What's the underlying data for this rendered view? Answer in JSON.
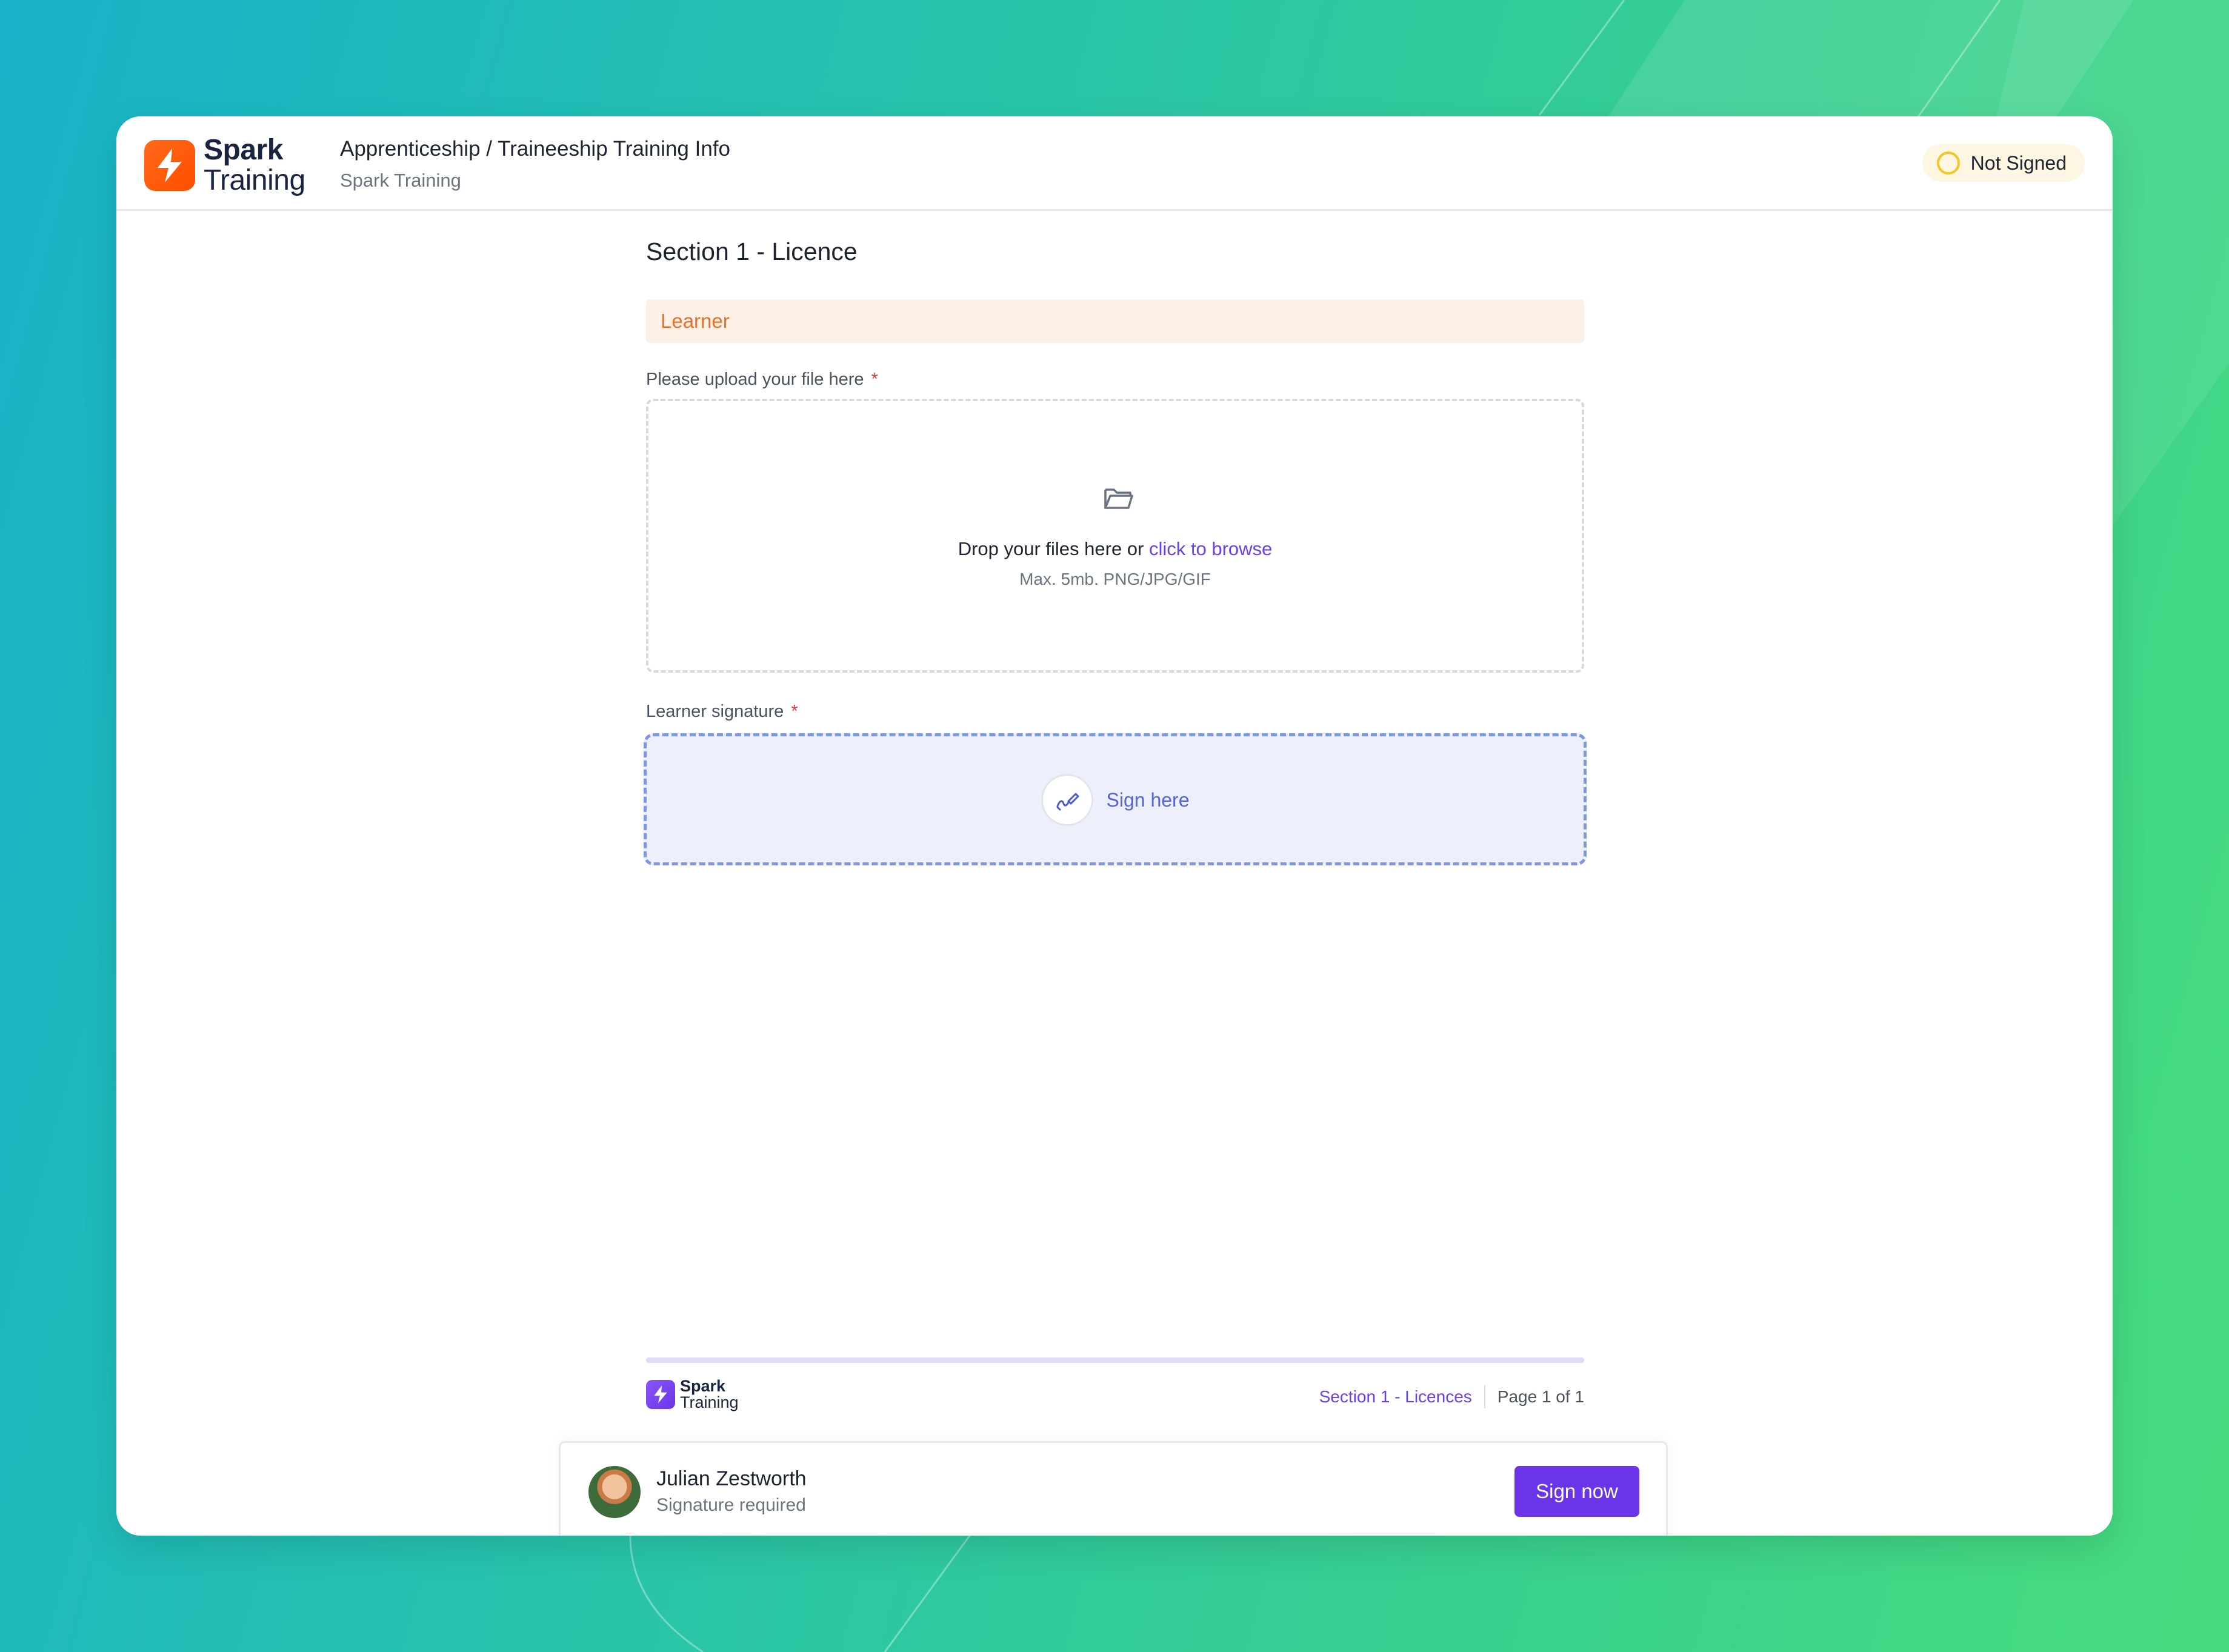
{
  "header": {
    "logo": {
      "line1": "Spark",
      "line2": "Training"
    },
    "title": "Apprenticeship / Traineeship Training Info",
    "subtitle": "Spark Training",
    "status": "Not Signed"
  },
  "section": {
    "title": "Section 1 - Licence",
    "role": "Learner"
  },
  "upload": {
    "label": "Please upload your file here",
    "required_mark": "*",
    "drop_text": "Drop your files here or",
    "browse_link": "click to browse",
    "hint": "Max. 5mb. PNG/JPG/GIF",
    "icon": "folder-open-icon"
  },
  "signature": {
    "label": "Learner signature",
    "required_mark": "*",
    "prompt": "Sign here",
    "icon": "signature-pen-icon"
  },
  "footer": {
    "logo": {
      "line1": "Spark",
      "line2": "Training"
    },
    "section": "Section 1 - Licences",
    "page": "Page 1 of 1"
  },
  "signer": {
    "name": "Julian Zestworth",
    "status": "Signature required",
    "button": "Sign now"
  },
  "colors": {
    "accent": "#6a35e8",
    "brand_orange": "#ff5a0f",
    "status_ring": "#f3c623",
    "role_text": "#e8712b",
    "sign_border": "#7d96e6"
  }
}
